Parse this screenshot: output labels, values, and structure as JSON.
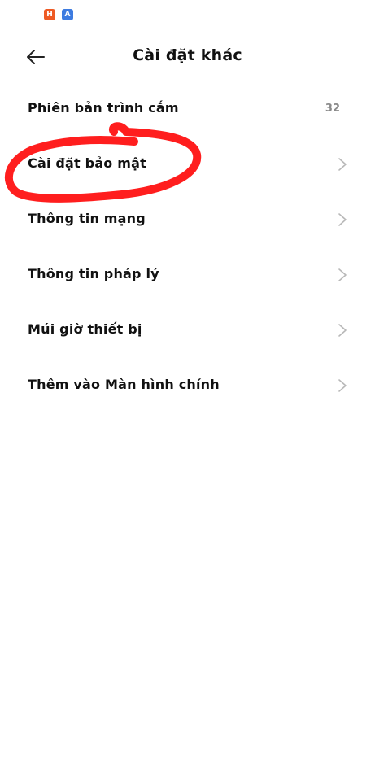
{
  "status_bar": {
    "notifications": [
      {
        "icon": "orange-app-notification-icon",
        "glyph": "H",
        "color": "#ee5a24"
      },
      {
        "icon": "translate-app-notification-icon",
        "glyph": "A",
        "color": "#3d7be0"
      }
    ]
  },
  "header": {
    "back_icon": "arrow-left-icon",
    "title": "Cài đặt khác"
  },
  "items": [
    {
      "label": "Phiên bản trình cắm",
      "value": "32"
    },
    {
      "label": "Cài đặt bảo mật",
      "chevron": "chevron-right-icon"
    },
    {
      "label": "Thông tin mạng",
      "chevron": "chevron-right-icon"
    },
    {
      "label": "Thông tin pháp lý",
      "chevron": "chevron-right-icon"
    },
    {
      "label": "Múi giờ thiết bị",
      "chevron": "chevron-right-icon"
    },
    {
      "label": "Thêm vào Màn hình chính",
      "chevron": "chevron-right-icon"
    }
  ],
  "colors": {
    "background": "#ffffff",
    "text": "#111111",
    "value_text": "#8a8a8a",
    "chevron": "#b8b8b8",
    "annotation": "#ff1e1e"
  }
}
